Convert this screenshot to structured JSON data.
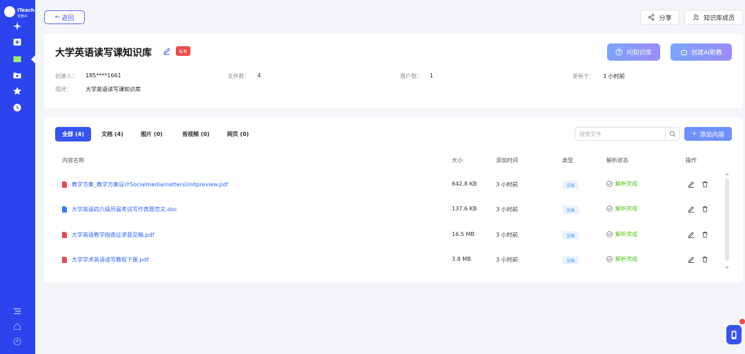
{
  "app": {
    "logo_text": "iTeach",
    "logo_sub": "爱教AI",
    "accent": "#2c44ee"
  },
  "sidebar": {
    "items": [
      {
        "icon": "sparkle-icon",
        "active": false
      },
      {
        "icon": "add-box-icon",
        "active": false
      },
      {
        "icon": "book-icon",
        "active": true
      },
      {
        "icon": "folder-icon",
        "active": false
      },
      {
        "icon": "star-icon",
        "active": false
      },
      {
        "icon": "clock-icon",
        "active": false
      }
    ],
    "bottom_items": [
      {
        "icon": "menu-icon"
      },
      {
        "icon": "home-icon"
      },
      {
        "icon": "user-icon"
      }
    ]
  },
  "topbar": {
    "back_label": "返回",
    "share_label": "分享",
    "members_label": "知识库成员"
  },
  "kb": {
    "title": "大学英语读写课知识库",
    "badge": "私有",
    "ask_label": "问知识库",
    "create_ai_label": "创建AI助教",
    "creator_label": "创建人：",
    "creator": "185****1661",
    "files_label": "文件数：",
    "files": "4",
    "users_label": "用户数：",
    "users": "1",
    "updated_label": "更新于：",
    "updated": "3 小时前",
    "desc_label": "描述：",
    "desc": "大学英语读写课知识库"
  },
  "tabs": [
    {
      "label": "全部 (4)",
      "active": true
    },
    {
      "label": "文档 (4)",
      "active": false
    },
    {
      "label": "图片 (0)",
      "active": false
    },
    {
      "label": "音视频 (0)",
      "active": false
    },
    {
      "label": "网页 (0)",
      "active": false
    }
  ],
  "search": {
    "placeholder": "搜索文件"
  },
  "add_label": "添加内容",
  "table": {
    "headers": {
      "name": "内容名称",
      "size": "大小",
      "time": "添加时间",
      "type": "类型",
      "status": "解析状态",
      "actions": "操作"
    },
    "rows": [
      {
        "name": "教学方案_教学方案设计SocialmediamattersUnitpreview.pdf",
        "file_type": "pdf",
        "size": "642.8 KB",
        "time": "3 小时前",
        "type": "文档",
        "status": "解析完成"
      },
      {
        "name": "大学英语四六级历届考试写作真题范文.doc",
        "file_type": "doc",
        "size": "137.6 KB",
        "time": "3 小时前",
        "type": "文档",
        "status": "解析完成"
      },
      {
        "name": "大学英语教学指南征求意见稿.pdf",
        "file_type": "pdf",
        "size": "16.5 MB",
        "time": "3 小时前",
        "type": "文档",
        "status": "解析完成"
      },
      {
        "name": "大学学术英语读写教程下册.pdf",
        "file_type": "pdf",
        "size": "3.8 MB",
        "time": "3 小时前",
        "type": "文档",
        "status": "解析完成"
      }
    ]
  },
  "colors": {
    "pdf": "#e5484d",
    "doc": "#2f7bf5",
    "status_ok": "#52c41a",
    "link": "#2f62ff"
  }
}
